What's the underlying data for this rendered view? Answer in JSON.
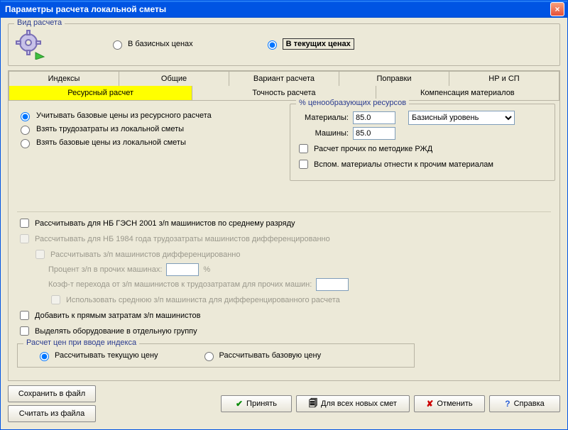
{
  "window": {
    "title": "Параметры расчета локальной сметы"
  },
  "calcType": {
    "legend": "Вид расчета",
    "basic": "В базисных ценах",
    "current": "В текущих ценах"
  },
  "tabs": {
    "row1": [
      "Индексы",
      "Общие",
      "Вариант расчета",
      "Поправки",
      "НР и СП"
    ],
    "row2": [
      "Ресурсный расчет",
      "Точность расчета",
      "Компенсация материалов"
    ]
  },
  "leftRadios": {
    "r1": "Учитывать базовые цены из ресурсного расчета",
    "r2": "Взять трудозатраты из локальной сметы",
    "r3": "Взять базовые цены из локальной сметы"
  },
  "pct": {
    "legend": "% ценообразующих ресурсов",
    "materials_lbl": "Материалы:",
    "machines_lbl": "Машины:",
    "materials_val": "85.0",
    "machines_val": "85.0",
    "level": "Базисный уровень",
    "rzhd": "Расчет прочих по методике РЖД",
    "vspom": "Вспом. материалы отнести к прочим материалам"
  },
  "checks": {
    "c1": "Рассчитывать для НБ ГЭСН 2001 з/п машинистов по среднему разряду",
    "c2": "Рассчитывать для НБ 1984 года трудозатраты машинистов дифференцированно",
    "c2a": "Рассчитывать з/п машинистов дифференцированно",
    "pct_lbl": "Процент з/п в прочих машинах:",
    "pct_suffix": "%",
    "coef_lbl": "Коэф-т перехода от з/п машинистов к трудозатратам для прочих машин:",
    "c2b": "Использовать среднюю з/п машиниста для дифференцированного расчета",
    "c3": "Добавить к прямым затратам з/п машинистов",
    "c4": "Выделять оборудование в отдельную группу"
  },
  "priceIndex": {
    "legend": "Расчет цен при вводе индекса",
    "r1": "Рассчитывать текущую цену",
    "r2": "Рассчитывать базовую цену"
  },
  "buttons": {
    "saveFile": "Сохранить в файл",
    "readFile": "Считать из файла",
    "accept": "Принять",
    "allNew": "Для всех новых смет",
    "cancel": "Отменить",
    "help": "Справка"
  }
}
